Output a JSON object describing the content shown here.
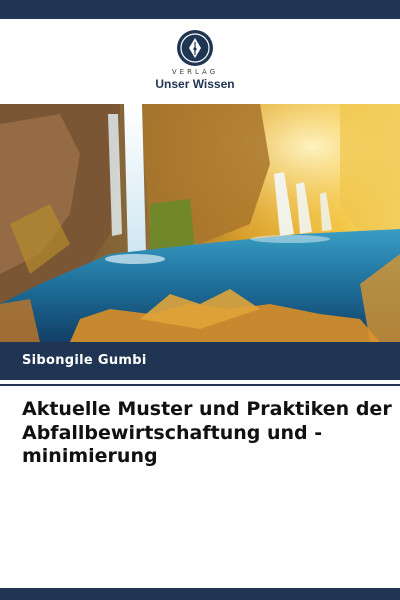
{
  "publisher": {
    "tagline": "VERLAG",
    "name": "Unser Wissen",
    "logo_icon": "pen-nib-icon"
  },
  "cover_image": {
    "subject": "waterfall-lake-autumn-icon"
  },
  "author": "Sibongile Gumbi",
  "title": "Aktuelle Muster und Praktiken der Abfallbewirtschaftung und -minimierung",
  "colors": {
    "brand": "#1f3553",
    "background": "#ffffff",
    "title_text": "#111111",
    "author_text": "#ffffff"
  }
}
